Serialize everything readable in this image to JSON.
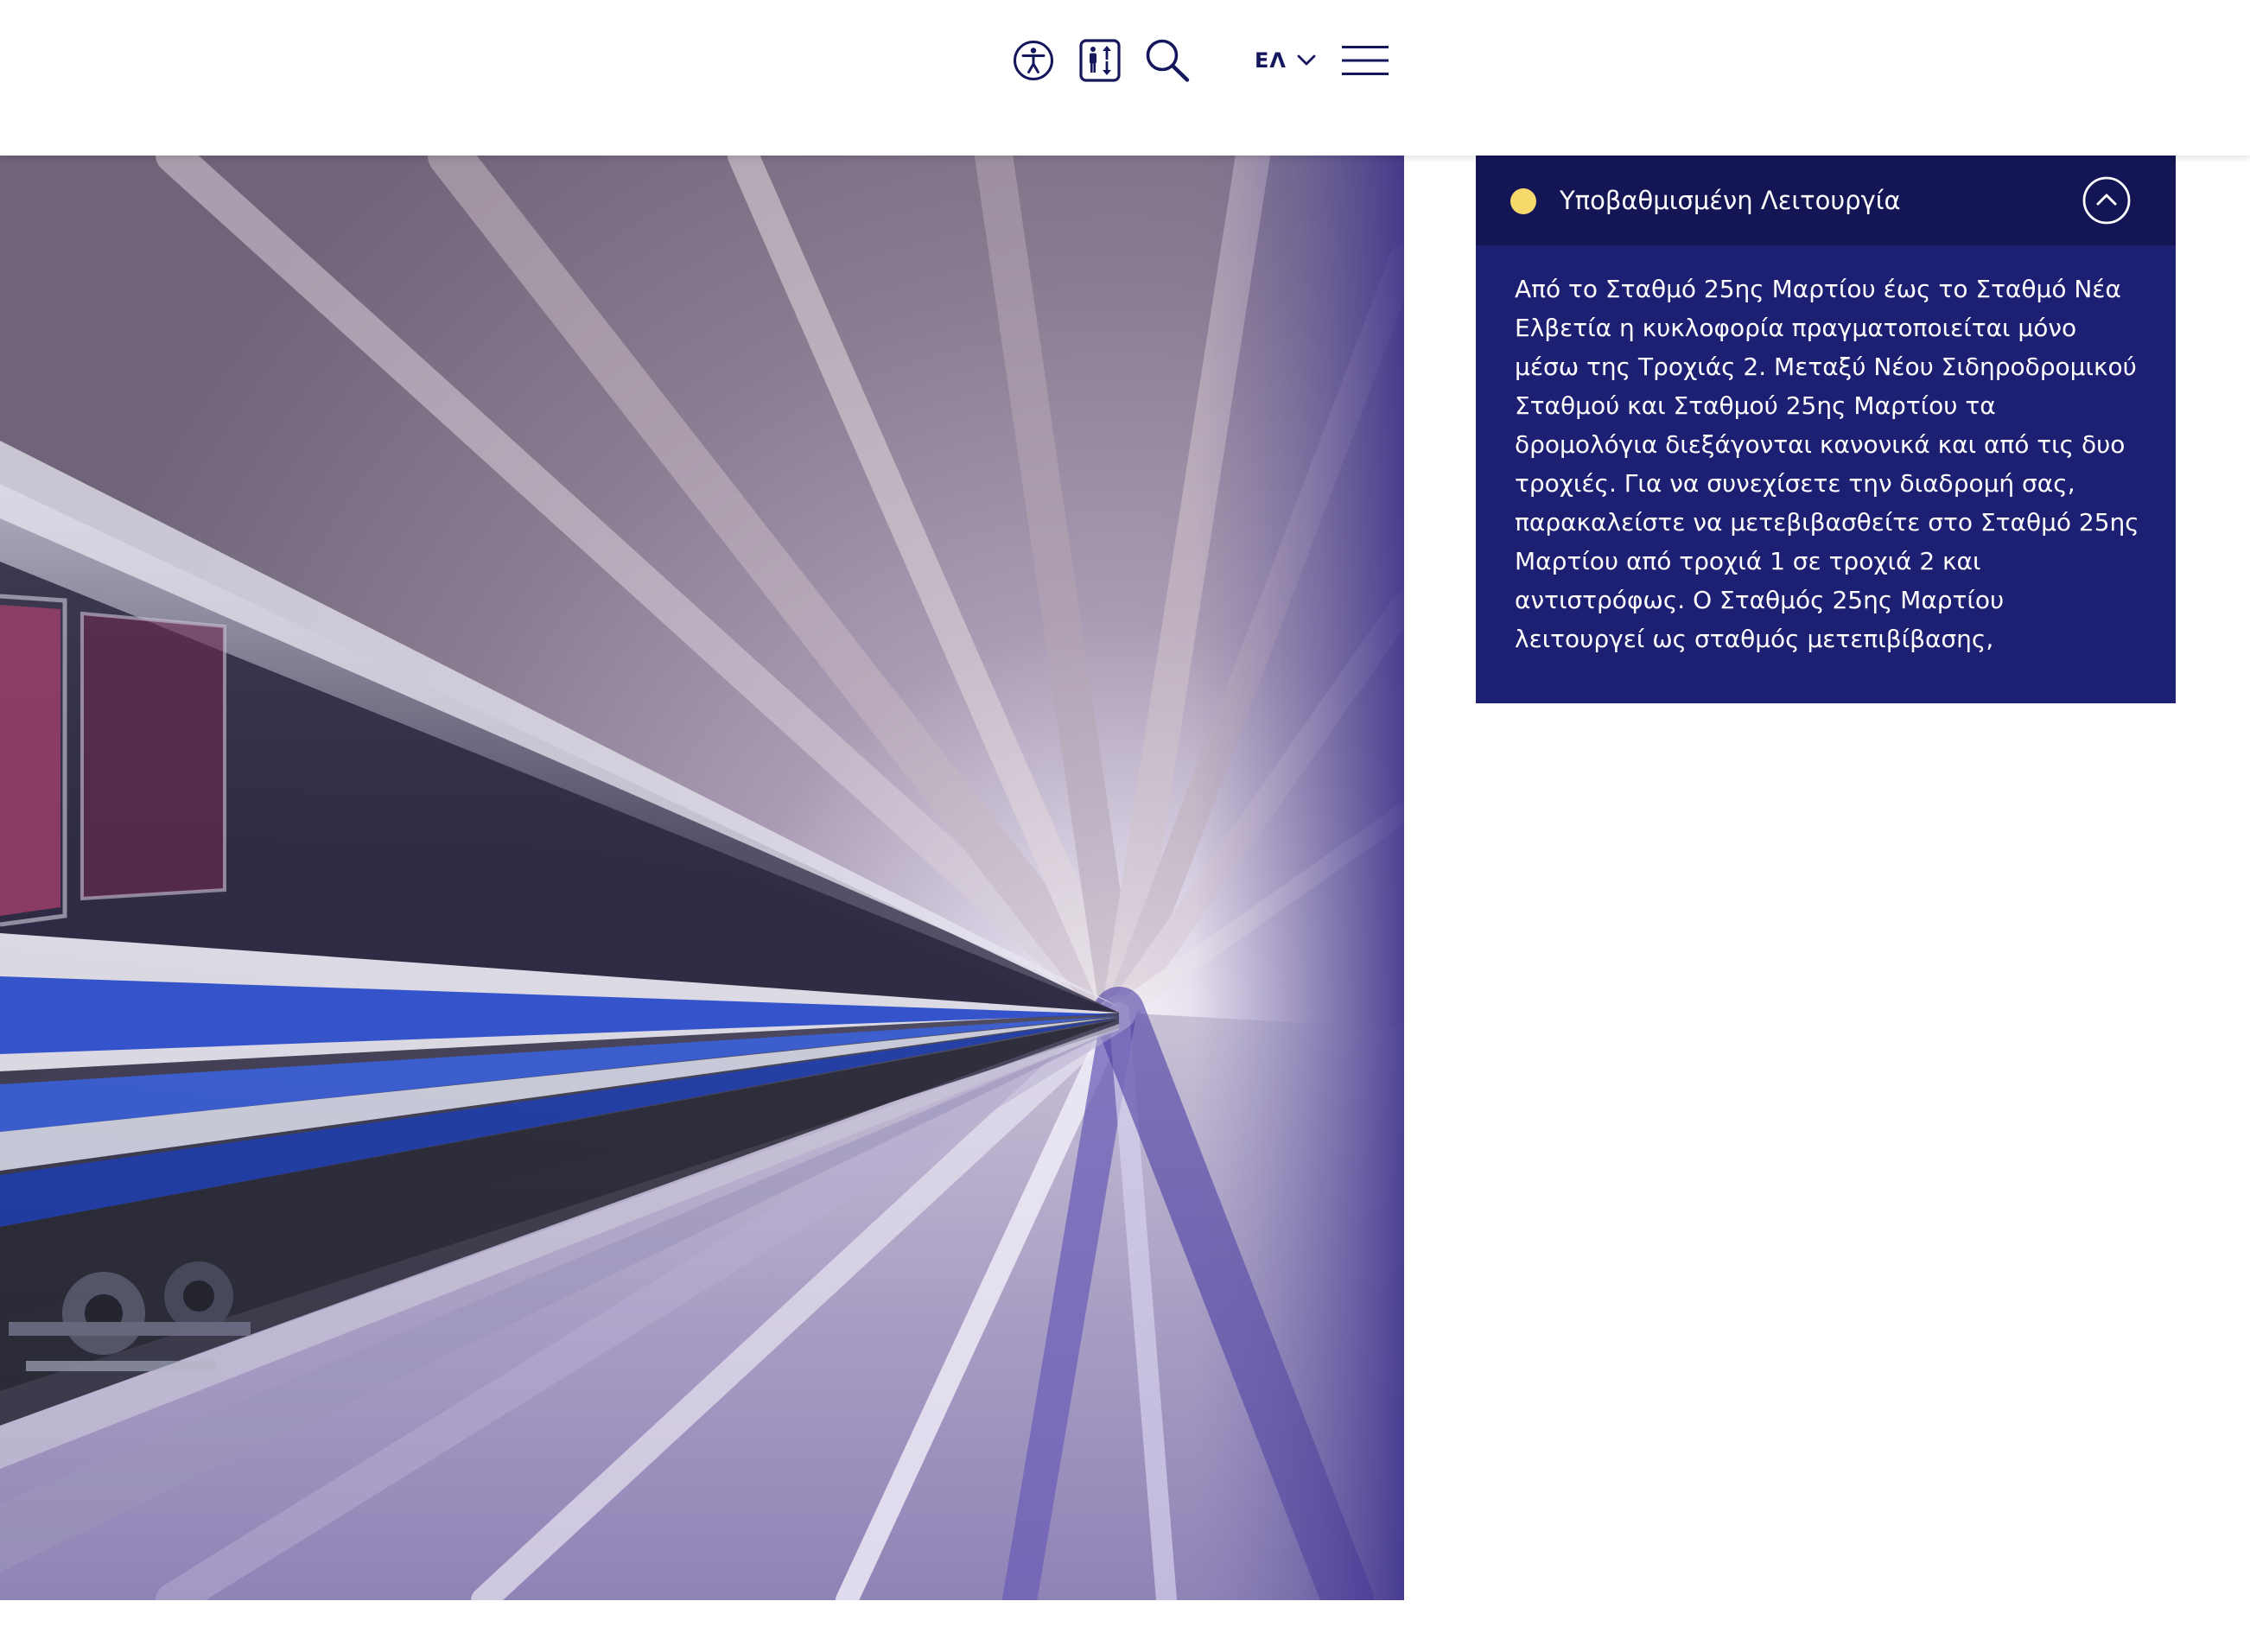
{
  "header": {
    "icons": {
      "accessibility": "accessibility-icon",
      "elevator": "elevator-icon",
      "search": "search-icon",
      "menu": "hamburger-menu-icon"
    },
    "language": {
      "selected": "ΕΛ"
    }
  },
  "hero": {
    "image": "train-motion-blur-photo"
  },
  "status": {
    "indicator_color": "#f5d96b",
    "title": "Υποβαθμισμένη Λειτουργία",
    "message": "Από το Σταθμό 25ης Μαρτίου έως το Σταθμό Νέα Ελβετία η κυκλοφορία πραγματοποιείται μόνο μέσω της Τροχιάς 2. Μεταξύ Νέου Σιδηροδρομικού Σταθμού και Σταθμού 25ης Μαρτίου τα δρομολόγια διεξάγονται κανονικά και από τις δυο τροχιές. Για να συνεχίσετε την διαδρομή σας, παρακαλείστε να μετεβιβασθείτε στο Σταθμό 25ης Μαρτίου από τροχιά 1 σε τροχιά 2 και αντιστρόφως. Ο Σταθμός 25ης Μαρτίου λειτουργεί ως σταθμός μετεπιβίβασης,"
  },
  "colors": {
    "brand_navy": "#141554",
    "panel_blue": "#1d1f72",
    "icon_navy": "#14175c"
  }
}
